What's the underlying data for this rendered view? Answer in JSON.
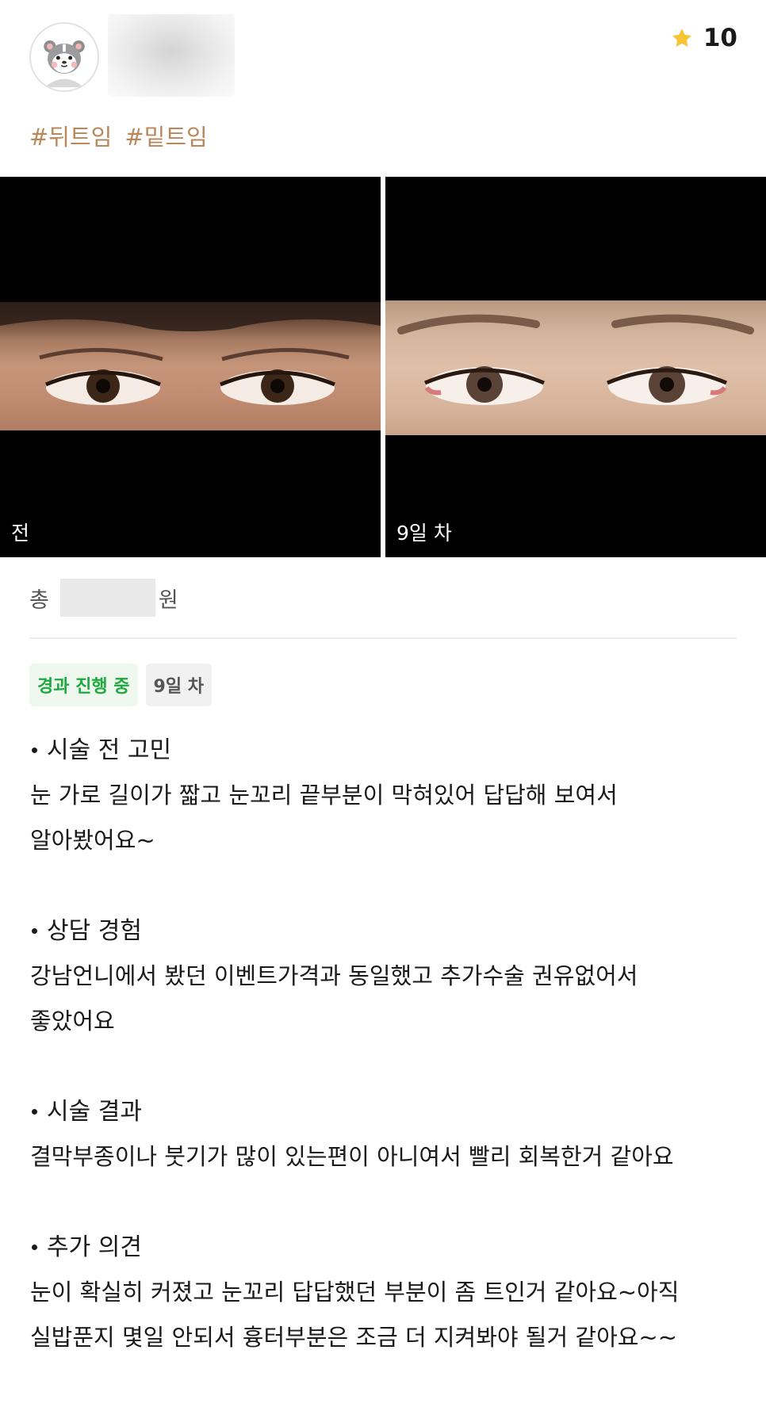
{
  "header": {
    "avatar": "avatar-icon",
    "rating_icon": "star-icon",
    "rating": "10",
    "tags": [
      "#뒤트임",
      "#밑트임"
    ],
    "colors": {
      "star": "#f7c531",
      "tag": "#b8875a"
    }
  },
  "photos": {
    "before_label": "전",
    "after_label": "9일 차"
  },
  "price": {
    "prefix": "총",
    "suffix": "원"
  },
  "badges": {
    "status": "경과 진행 중",
    "day": "9일 차",
    "colors": {
      "status_text": "#1fa83e",
      "status_bg": "#eef8ef"
    }
  },
  "review": {
    "sections": [
      {
        "title": "시술 전 고민",
        "body_lines": [
          "눈 가로 길이가 짧고 눈꼬리 끝부분이 막혀있어 답답해 보여서",
          "알아봤어요~"
        ]
      },
      {
        "title": "상담 경험",
        "body_lines": [
          "강남언니에서 봤던 이벤트가격과 동일했고 추가수술 권유없어서",
          "좋았어요"
        ]
      },
      {
        "title": "시술 결과",
        "body_lines": [
          "결막부종이나 붓기가 많이 있는편이 아니여서 빨리 회복한거 같아요"
        ]
      },
      {
        "title": "추가 의견",
        "body_lines": [
          "눈이 확실히 커졌고 눈꼬리 답답했던 부분이 좀 트인거 같아요~아직",
          "실밥푼지 몇일 안되서 흉터부분은 조금 더 지켜봐야 될거 같아요~~"
        ]
      }
    ]
  }
}
